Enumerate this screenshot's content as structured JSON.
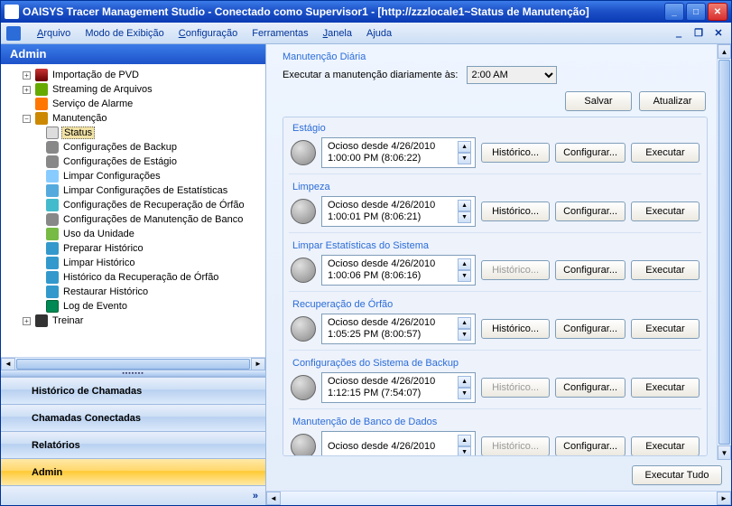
{
  "window": {
    "title": "OAISYS Tracer Management Studio - Conectado como Supervisor1 - [http://zzzlocale1~Status de Manutenção]"
  },
  "menu": {
    "arquivo": "Arquivo",
    "modo": "Modo de Exibição",
    "config": "Configuração",
    "ferramentas": "Ferramentas",
    "janela": "Janela",
    "ajuda": "Ajuda"
  },
  "sidebar": {
    "title": "Admin",
    "tree": {
      "pvd": "Importação de PVD",
      "stream": "Streaming de Arquivos",
      "alarm": "Serviço de Alarme",
      "maint": "Manutenção",
      "status": "Status",
      "backupcfg": "Configurações de Backup",
      "stagecfg": "Configurações de Estágio",
      "clearcfg": "Limpar Configurações",
      "clearstats": "Limpar Configurações de Estatísticas",
      "recovercfg": "Configurações de Recuperação de Órfão",
      "maintcfg": "Configurações de Manutenção de Banco",
      "unitusage": "Uso da Unidade",
      "prephist": "Preparar Histórico",
      "clearhist": "Limpar Histórico",
      "orphanhist": "Histórico da Recuperação de Órfão",
      "restorehist": "Restaurar Histórico",
      "eventlog": "Log de Evento",
      "train": "Treinar"
    },
    "nav": {
      "callhist": "Histórico de Chamadas",
      "connected": "Chamadas Conectadas",
      "reports": "Relatórios",
      "admin": "Admin"
    }
  },
  "main": {
    "daily_title": "Manutenção Diária",
    "daily_label": "Executar a manutenção diariamente às:",
    "daily_time": "2:00 AM",
    "save": "Salvar",
    "refresh": "Atualizar",
    "history_btn": "Histórico...",
    "config_btn": "Configurar...",
    "run_btn": "Executar",
    "runall_btn": "Executar Tudo",
    "groups": [
      {
        "name": "Estágio",
        "line1": "Ocioso desde 4/26/2010",
        "line2": "1:00:00 PM (8:06:22)",
        "hist": true
      },
      {
        "name": "Limpeza",
        "line1": "Ocioso desde 4/26/2010",
        "line2": "1:00:01 PM (8:06:21)",
        "hist": true
      },
      {
        "name": "Limpar Estatísticas do Sistema",
        "line1": "Ocioso desde 4/26/2010",
        "line2": "1:00:06 PM (8:06:16)",
        "hist": false
      },
      {
        "name": "Recuperação de Órfão",
        "line1": "Ocioso desde 4/26/2010",
        "line2": "1:05:25 PM (8:00:57)",
        "hist": true
      },
      {
        "name": "Configurações do Sistema de Backup",
        "line1": "Ocioso desde 4/26/2010",
        "line2": "1:12:15 PM (7:54:07)",
        "hist": false
      },
      {
        "name": "Manutenção de Banco de Dados",
        "line1": "Ocioso desde 4/26/2010",
        "line2": "",
        "hist": false
      }
    ]
  }
}
